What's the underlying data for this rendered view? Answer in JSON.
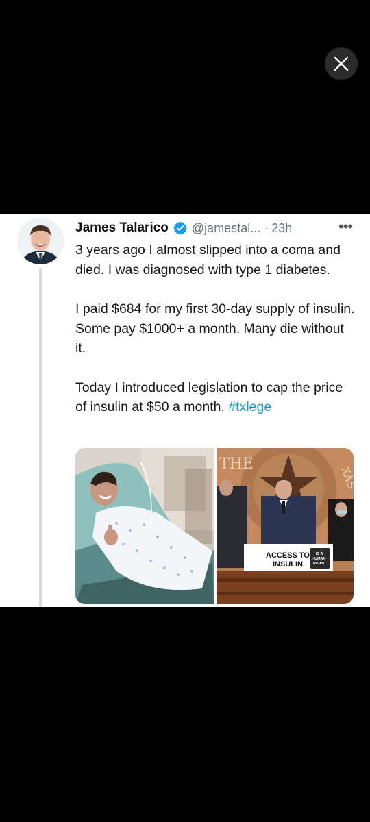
{
  "viewer": {
    "close_icon": "close-icon"
  },
  "tweet": {
    "author_name": "James Talarico",
    "handle": "@jamestal...",
    "separator": "·",
    "time": "23h",
    "more_label": "•••",
    "paragraphs": [
      "3 years ago I almost slipped into a coma and died. I was diagnosed with type 1 diabetes.",
      "I paid $684 for my first 30-day supply of insulin. Some pay $1000+ a month. Many die without it.",
      "Today I introduced legislation to cap the price of insulin at $50 a month."
    ],
    "hashtag": "#txlege",
    "photo_right": {
      "sign_line1": "ACCESS TO",
      "sign_line2": "INSULIN",
      "badge_line1": "IS A",
      "badge_line2": "HUMAN",
      "badge_line3": "RIGHT",
      "seal_letters_left": "THE",
      "seal_letters_right": "XAS"
    }
  },
  "colors": {
    "accent": "#1a9bc3",
    "verified": "#1d9bf0",
    "background": "#000000"
  }
}
